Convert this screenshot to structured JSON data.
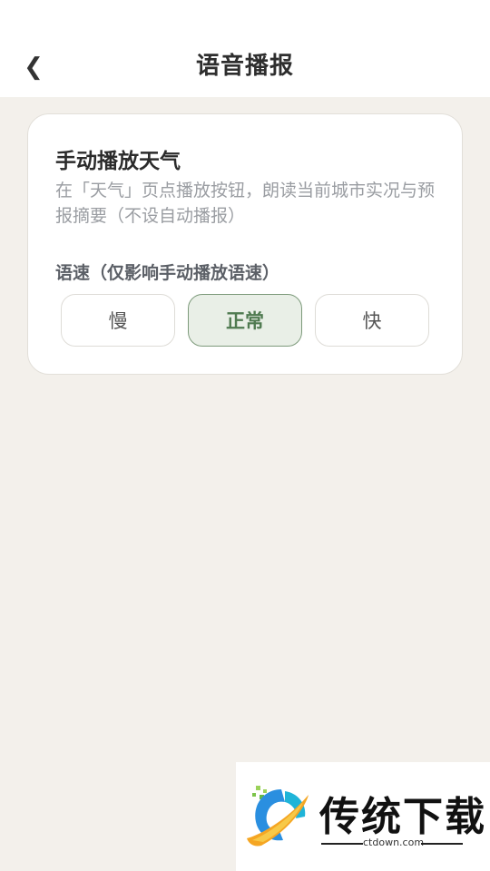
{
  "header": {
    "back_icon": "chevron-left-icon",
    "back_glyph": "❮",
    "title": "语音播报"
  },
  "card": {
    "title": "手动播放天气",
    "description": "在「天气」页点播放按钮，朗读当前城市实况与预报摘要（不设自动播报）",
    "speed_label": "语速（仅影响手动播放语速）",
    "speed_options": [
      {
        "label": "慢",
        "selected": false
      },
      {
        "label": "正常",
        "selected": true
      },
      {
        "label": "快",
        "selected": false
      }
    ]
  },
  "watermark": {
    "text": "传统下载",
    "url": "ctdown.com"
  },
  "colors": {
    "background": "#f3f0eb",
    "card": "#ffffff",
    "accent": "#7d9a7b",
    "accent_bg": "#e9efe7",
    "muted_text": "#9a9da2"
  }
}
